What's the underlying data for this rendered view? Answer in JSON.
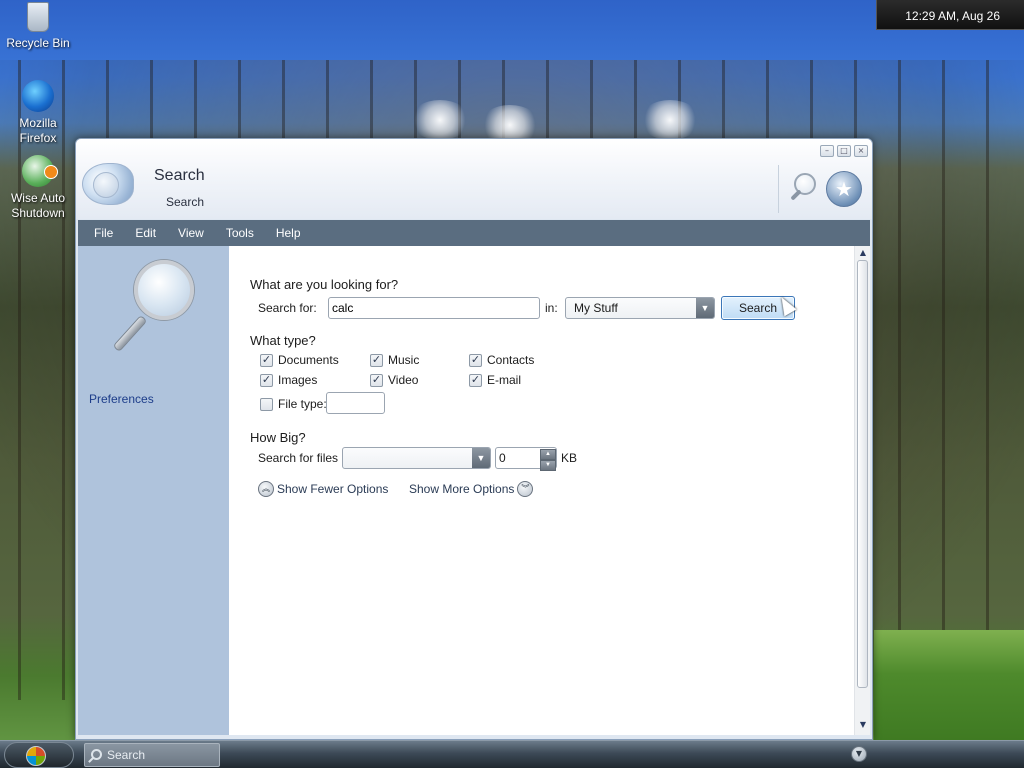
{
  "desktop": {
    "icons": [
      {
        "label": "Recycle Bin"
      },
      {
        "label": "Mozilla Firefox"
      },
      {
        "label": "Wise Auto Shutdown"
      }
    ],
    "clock": "12:29 AM, Aug 26"
  },
  "window": {
    "title": "Search",
    "subtitle": "Search",
    "controls": {
      "minimize": "–",
      "maximize": "□",
      "close": "×"
    }
  },
  "menu": {
    "items": [
      "File",
      "Edit",
      "View",
      "Tools",
      "Help"
    ]
  },
  "sidebar": {
    "preferences_label": "Preferences"
  },
  "search": {
    "heading": "What are you looking for?",
    "search_for_label": "Search for:",
    "query": "calc",
    "in_label": "in:",
    "location": "My Stuff",
    "button_label": "Search"
  },
  "type": {
    "heading": "What type?",
    "options": [
      {
        "label": "Documents",
        "checked": true
      },
      {
        "label": "Music",
        "checked": true
      },
      {
        "label": "Contacts",
        "checked": true
      },
      {
        "label": "Images",
        "checked": true
      },
      {
        "label": "Video",
        "checked": true
      },
      {
        "label": "E-mail",
        "checked": true
      }
    ],
    "file_type_label": "File type:",
    "file_type_checked": false,
    "file_type_value": ""
  },
  "size": {
    "heading": "How Big?",
    "search_for_files_label": "Search for files",
    "size_mode": "",
    "size_value": "0",
    "unit": "KB"
  },
  "options": {
    "fewer_label": "Show Fewer Options",
    "more_label": "Show More Options"
  },
  "taskbar": {
    "search_placeholder": "Search"
  },
  "colors": {
    "menubar": "#5a6d80",
    "sidebar": "#afc3dc",
    "link": "#1d3d8a",
    "search_button": "#bfdcf5"
  }
}
